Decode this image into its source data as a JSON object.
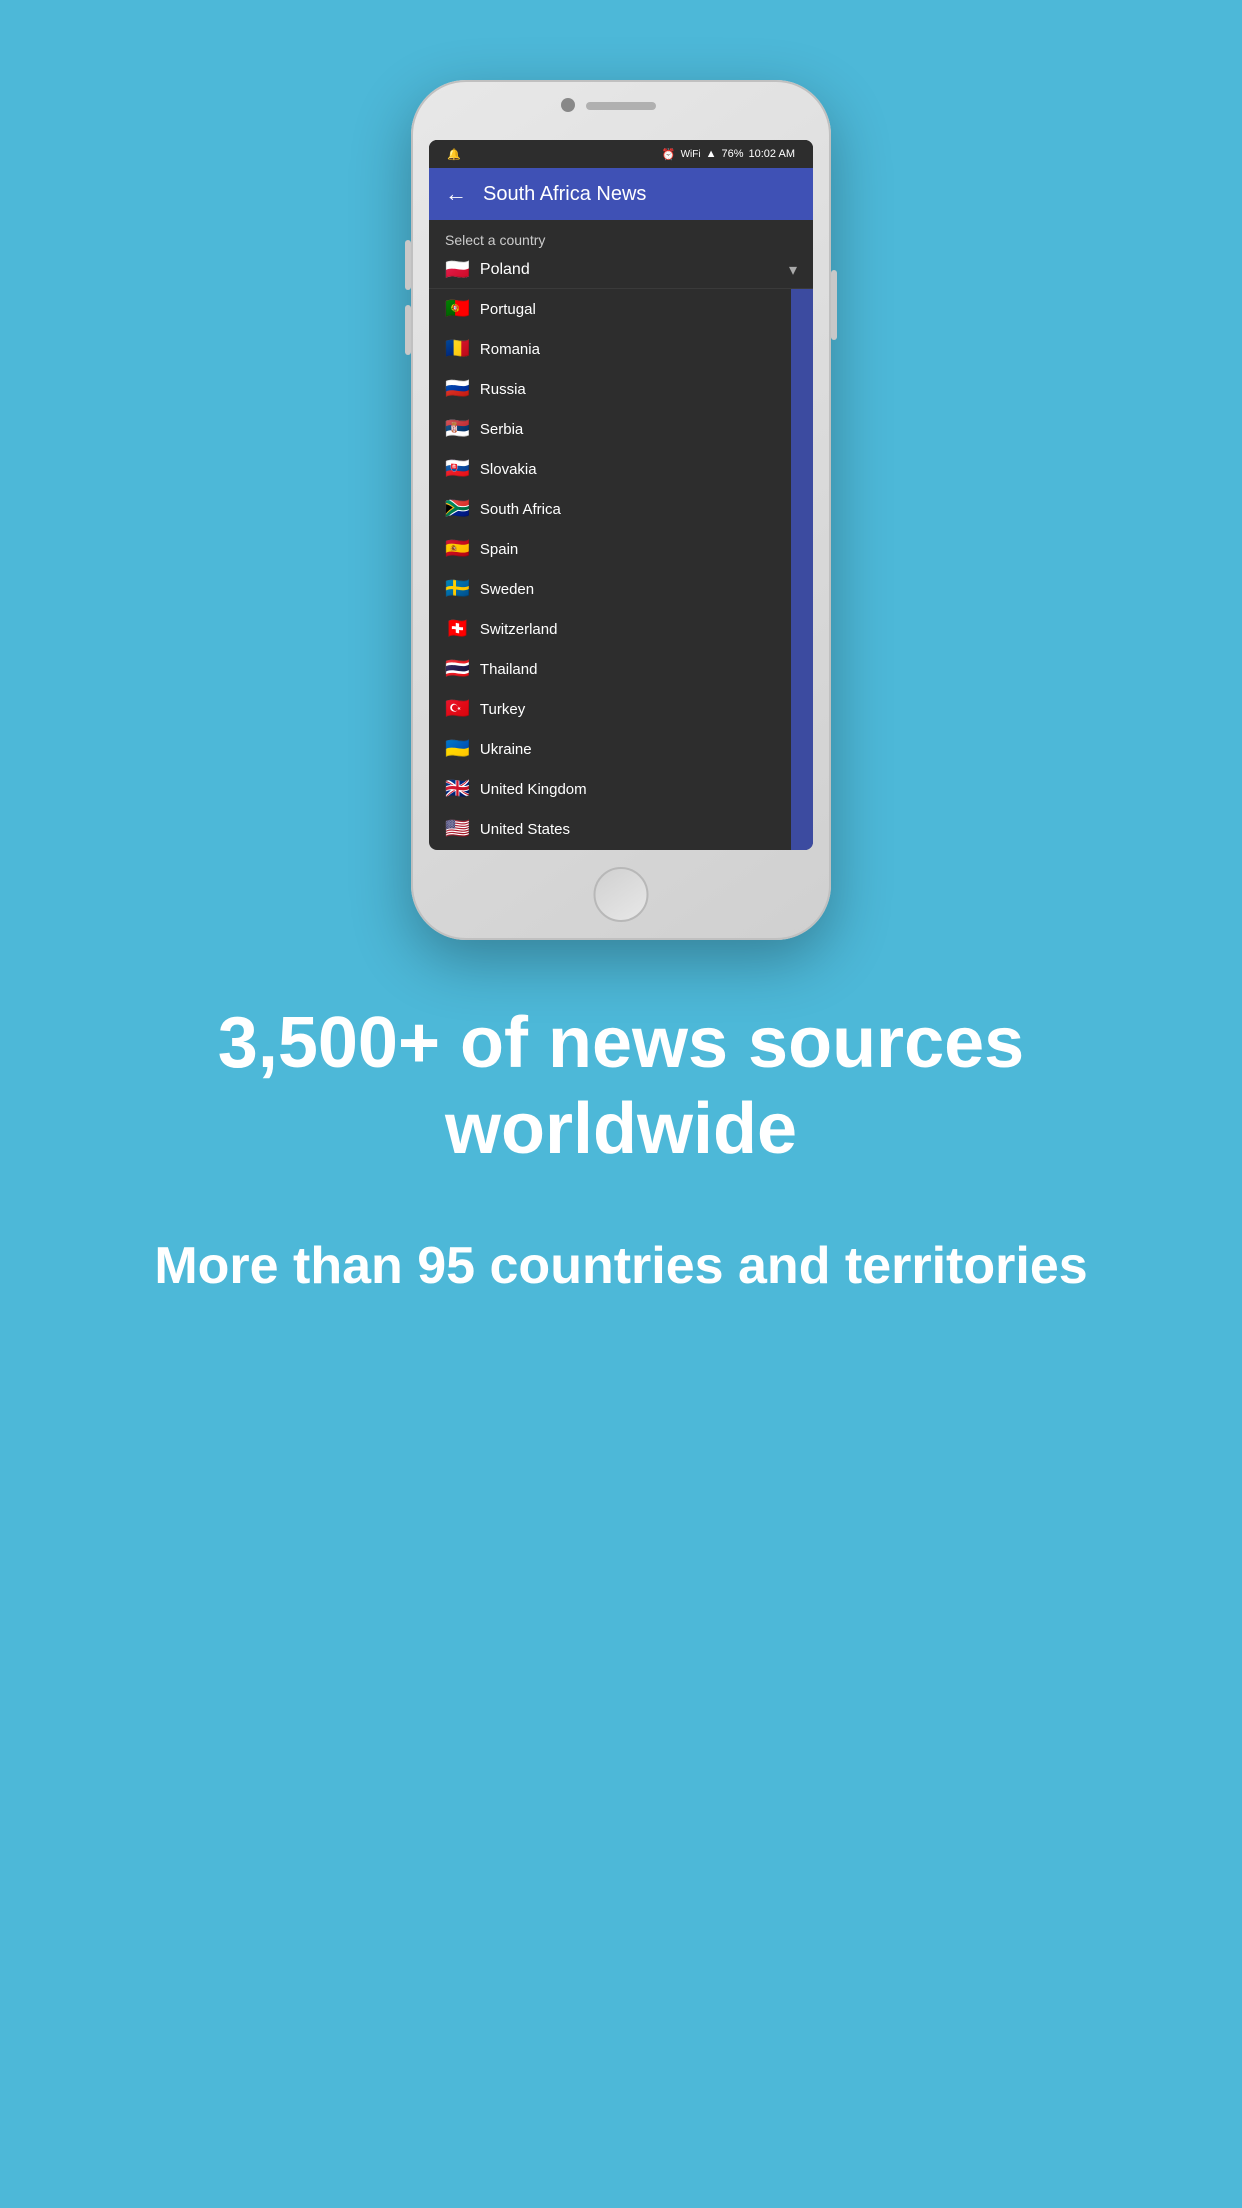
{
  "background_color": "#4db8d8",
  "phone": {
    "status_bar": {
      "left_icon": "🔔",
      "alarm": "⏰",
      "wifi": "WiFi",
      "signal": "📶",
      "battery": "76%",
      "time": "10:02 AM"
    },
    "app_bar": {
      "back_label": "←",
      "title": "South Africa News"
    },
    "select_label": "Select a country",
    "dropdown": {
      "selected": "Poland",
      "flag": "🇵🇱"
    },
    "countries": [
      {
        "name": "Portugal",
        "flag": "🇵🇹"
      },
      {
        "name": "Romania",
        "flag": "🇷🇴"
      },
      {
        "name": "Russia",
        "flag": "🇷🇺"
      },
      {
        "name": "Serbia",
        "flag": "🇷🇸"
      },
      {
        "name": "Slovakia",
        "flag": "🇸🇰"
      },
      {
        "name": "South Africa",
        "flag": "🇿🇦"
      },
      {
        "name": "Spain",
        "flag": "🇪🇸"
      },
      {
        "name": "Sweden",
        "flag": "🇸🇪"
      },
      {
        "name": "Switzerland",
        "flag": "🇨🇭"
      },
      {
        "name": "Thailand",
        "flag": "🇹🇭"
      },
      {
        "name": "Turkey",
        "flag": "🇹🇷"
      },
      {
        "name": "Ukraine",
        "flag": "🇺🇦"
      },
      {
        "name": "United Kingdom",
        "flag": "🇬🇧"
      },
      {
        "name": "United States",
        "flag": "🇺🇸"
      }
    ]
  },
  "bottom": {
    "headline": "3,500+ of news sources worldwide",
    "subheadline": "More than 95 countries and territories"
  }
}
